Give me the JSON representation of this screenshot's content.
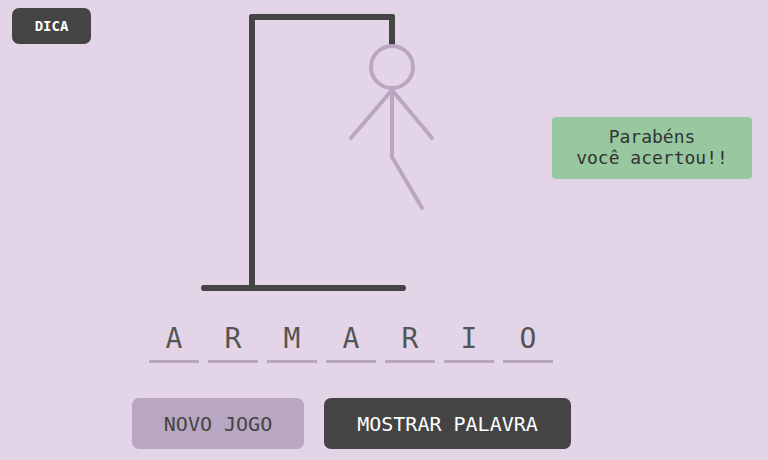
{
  "hint_button": {
    "label": "DICA"
  },
  "hangman": {
    "parts": [
      {
        "kind": "head",
        "shown": true
      },
      {
        "kind": "body",
        "shown": true
      },
      {
        "kind": "left-arm",
        "shown": true
      },
      {
        "kind": "right-arm",
        "shown": true
      },
      {
        "kind": "right-leg",
        "shown": true
      },
      {
        "kind": "left-leg",
        "shown": false
      }
    ]
  },
  "message": {
    "lines": [
      "Parabéns",
      "você acertou!!"
    ]
  },
  "word": [
    {
      "letter": "A",
      "revealed": true
    },
    {
      "letter": "R",
      "revealed": true
    },
    {
      "letter": "M",
      "revealed": true
    },
    {
      "letter": "A",
      "revealed": true
    },
    {
      "letter": "R",
      "revealed": true
    },
    {
      "letter": "I",
      "revealed": true
    },
    {
      "letter": "O",
      "revealed": true
    }
  ],
  "buttons": [
    {
      "label": "NOVO JOGO",
      "kind": "light"
    },
    {
      "label": "MOSTRAR PALAVRA",
      "kind": "dark"
    }
  ]
}
